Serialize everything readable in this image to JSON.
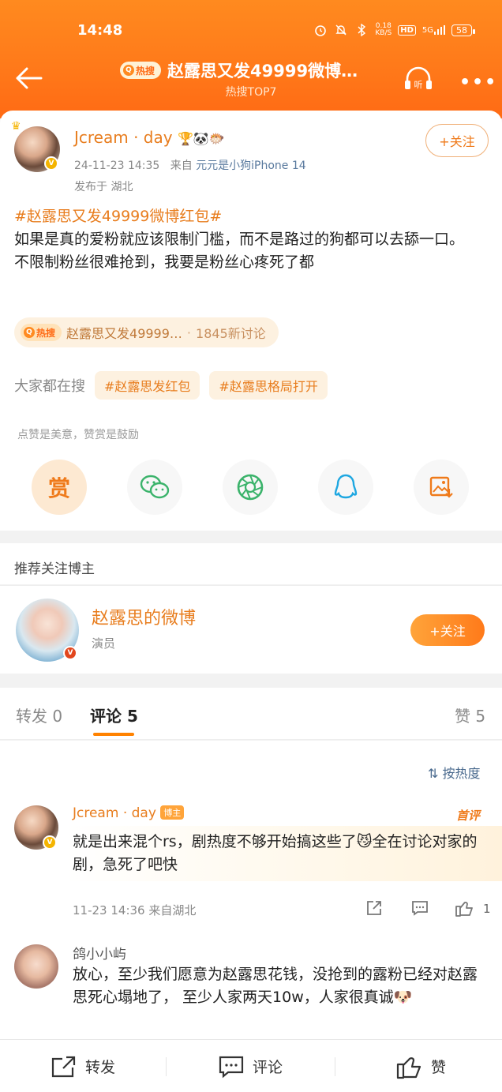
{
  "status_bar": {
    "time": "14:48",
    "net_speed": "0.18\nKB/S",
    "hd": "HD",
    "signal": "5G",
    "battery": "58"
  },
  "header": {
    "hot_label": "热搜",
    "title": "赵露思又发49999微博…",
    "subtitle": "热搜TOP7"
  },
  "post": {
    "username": "Jcream · day",
    "user_emojis": "🏆🐼🐡",
    "timestamp": "24-11-23 14:35",
    "from_label": "来自",
    "source": "元元是小狗iPhone 14",
    "location": "发布于 湖北",
    "follow_label": "+关注",
    "hashtag": "#赵露思又发49999微博红包#",
    "body_line1": "如果是真的爱粉就应该限制门槛，而不是路过的狗都可以去舔一口。",
    "body_line2": "不限制粉丝很难抢到，我要是粉丝心疼死了都",
    "hot_chip": {
      "label": "热搜",
      "title": "赵露思又发49999…",
      "sep": "·",
      "discussion": "1845新讨论"
    },
    "search_label": "大家都在搜",
    "search_chips": [
      "#赵露思发红包",
      "#赵露思格局打开"
    ],
    "reward_hint": "点赞是美意，赞赏是鼓励",
    "reward_label": "赏"
  },
  "recommend": {
    "section_title": "推荐关注博主",
    "name": "赵露思的微博",
    "role": "演员",
    "follow_label": "+关注"
  },
  "tabs": [
    {
      "label": "转发 0"
    },
    {
      "label": "评论 5"
    },
    {
      "label": "赞 5"
    }
  ],
  "comments": {
    "sort_label": "按热度",
    "items": [
      {
        "user": "Jcream · day",
        "badge": "博主",
        "first_review": "首评",
        "text": "就是出来混个rs，剧热度不够开始搞这些了😼全在讨论对家的剧，急死了吧快",
        "meta": "11-23 14:36 来自湖北",
        "likes": "1"
      },
      {
        "user": "鸽小小屿",
        "text": "放心，至少我们愿意为赵露思花钱，没抢到的露粉已经对赵露思死心塌地了， 至少人家两天10w，人家很真诚🐶"
      }
    ]
  },
  "bottom_bar": {
    "repost": "转发",
    "comment": "评论",
    "like": "赞"
  },
  "colors": {
    "brand_orange": "#ff7a1a",
    "link_orange": "#e87d1e",
    "source_blue": "#5a7a9e"
  }
}
